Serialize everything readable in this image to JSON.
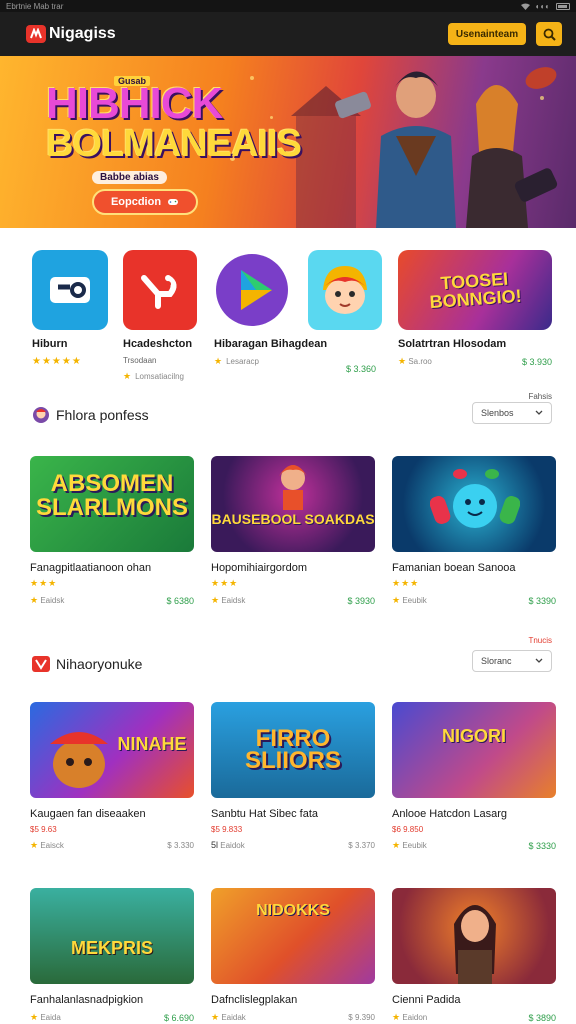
{
  "status_bar": {
    "left": "Ebrtnie Mab trar"
  },
  "header": {
    "logo_text": "Nigagiss",
    "primary_button": "Usenainteam",
    "brand_color": "#f5b317"
  },
  "hero": {
    "title_line1": "HIBHICK",
    "title_line2": "BOLMANEAIIS",
    "badge": "Gusab",
    "tagline": "Babbe abias",
    "cta_label": "Eopcdion"
  },
  "featured": [
    {
      "title": "Hiburn",
      "rating": 5,
      "sub": ""
    },
    {
      "title": "Hcadeshcton",
      "rating": 1,
      "sub": "Lomsatiacilng",
      "subtitle2": "Trsodaan"
    },
    {
      "title": "Hibaragan Bihagdean",
      "rating": 1,
      "sub": "Lesaracp"
    },
    {
      "title": "",
      "rating": 0,
      "sub": "",
      "price": "$ 3.360"
    },
    {
      "title": "Solatrtran Hlosodam",
      "rating": 1,
      "sub": "Sa.roo",
      "price": "$ 3.930",
      "banner": "TOOSEI BONNGIO!"
    }
  ],
  "section1": {
    "title": "Fhlora ponfess",
    "link": "Fahsis",
    "dropdown": "Slenbos",
    "cards": [
      {
        "title": "Fanagpitlaatianoon ohan",
        "rating": 3,
        "sub": "Eaidsk",
        "price": "$ 6380",
        "art": "ABSOMEN SLARLMONS"
      },
      {
        "title": "Hopomihiairgordom",
        "rating": 3,
        "sub": "Eaidsk",
        "price": "$ 3930",
        "art": "BAUSEBOOL SOAKDAS"
      },
      {
        "title": "Famanian boean Sanooa",
        "rating": 3,
        "sub": "Eeubik",
        "price": "$ 3390",
        "art": ""
      }
    ]
  },
  "section2": {
    "title": "Nihaoryonuke",
    "link": "Tnucis",
    "dropdown": "Sloranc",
    "cards": [
      {
        "title": "Kaugaen fan diseaaken",
        "tag": "$5 9.63",
        "sub": "Eaisck",
        "price": "$ 3.330",
        "art": "NINAHE"
      },
      {
        "title": "Sanbtu Hat Sibec fata",
        "tag": "$5 9.833",
        "sub": "Eaidok",
        "price": "$ 3.370",
        "art": "FIRRO SLIIORS"
      },
      {
        "title": "Anlooe Hatcdon Lasarg",
        "tag": "$6 9.850",
        "sub": "Eeubik",
        "price": "$ 3330",
        "art": "NIGORI"
      }
    ]
  },
  "section3": {
    "cards": [
      {
        "title": "Fanhalanlasnadpigkion",
        "sub": "Eaida",
        "price": "$ 6.690",
        "art": "MEKPRIS"
      },
      {
        "title": "Dafnclislegplakan",
        "sub": "Eaidak",
        "price": "$ 9.390",
        "art": "NIDOKKS"
      },
      {
        "title": "Cienni Padida",
        "sub": "Eaidon",
        "price": "$ 3890",
        "art": ""
      }
    ]
  }
}
